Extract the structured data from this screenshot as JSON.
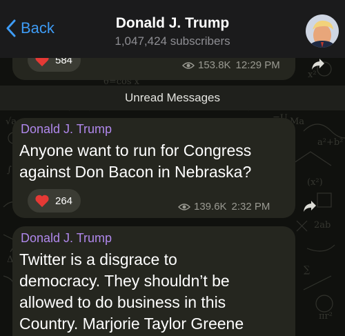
{
  "header": {
    "back_label": "Back",
    "channel_title": "Donald J. Trump",
    "subscribers": "1,047,424 subscribers"
  },
  "messages": [
    {
      "reaction_count": "584",
      "views": "153.8K",
      "time": "12:29 PM"
    },
    {
      "sender": "Donald J. Trump",
      "text_lines": [
        "Anyone want to run for Congress",
        "against Don Bacon in Nebraska?"
      ],
      "reaction_count": "264",
      "views": "139.6K",
      "time": "2:32 PM"
    },
    {
      "sender": "Donald J. Trump",
      "text_lines": [
        "Twitter is a disgrace to",
        "democracy. They shouldn’t be",
        "allowed to do business in this",
        "Country. Marjorie Taylor Greene"
      ]
    }
  ],
  "unread_label": "Unread Messages",
  "icons": {
    "back": "chevron-left-icon",
    "heart": "heart-icon",
    "views": "eye-icon",
    "share": "share-arrow-icon"
  },
  "colors": {
    "accent": "#3e9cf6",
    "sender": "#b088ec",
    "heart": "#e53935",
    "bubble": "#25261f"
  }
}
